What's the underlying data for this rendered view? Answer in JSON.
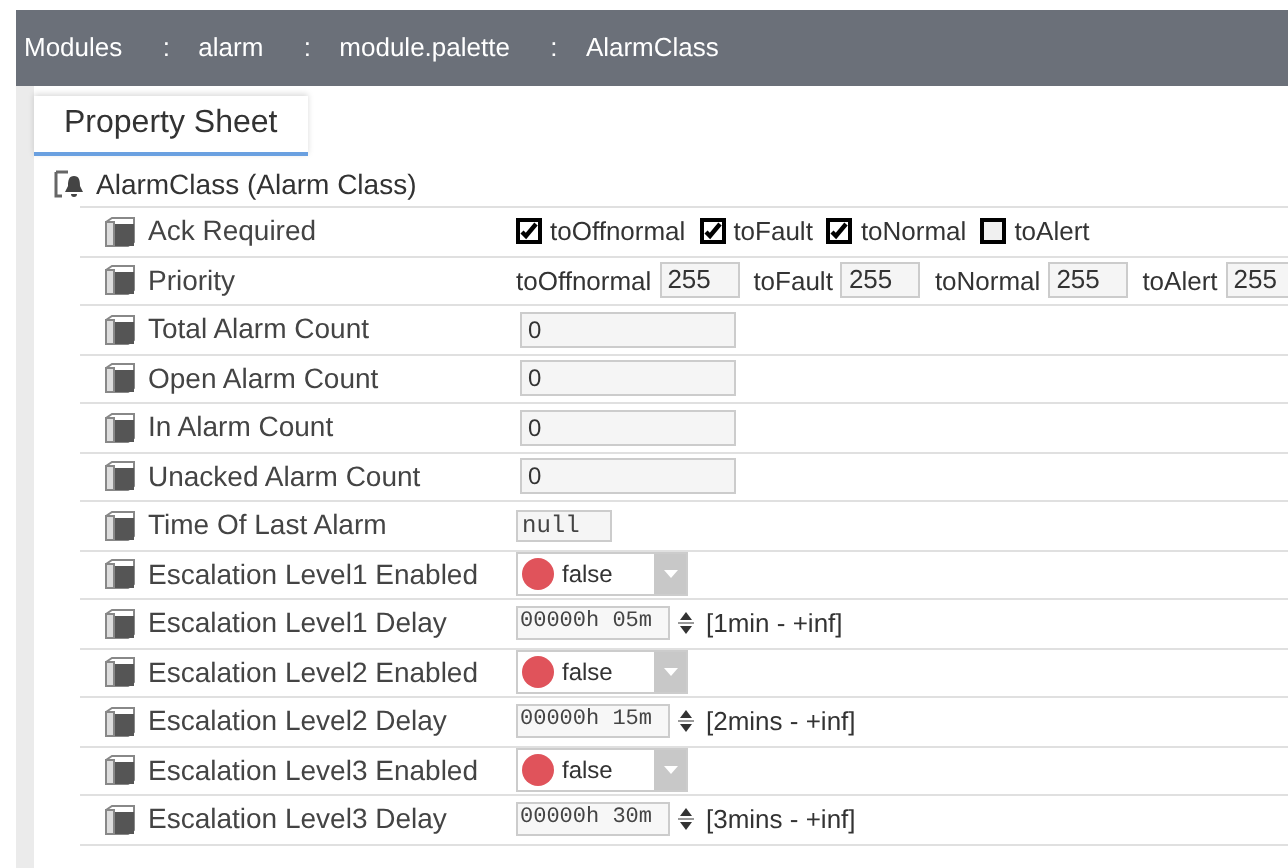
{
  "breadcrumb": [
    {
      "label": "Modules"
    },
    {
      "separator": ":",
      "label": "alarm"
    },
    {
      "separator": ":",
      "label": "module.palette"
    },
    {
      "separator": ":",
      "label": "AlarmClass"
    }
  ],
  "tabs": [
    {
      "label": "Property Sheet",
      "selected": true
    }
  ],
  "root": {
    "label": "AlarmClass  (Alarm Class)"
  },
  "properties": [
    {
      "label": "Ack Required",
      "kind": "checks",
      "checks": [
        {
          "label": "toOffnormal",
          "checked": true
        },
        {
          "label": "toFault",
          "checked": true
        },
        {
          "label": "toNormal",
          "checked": true
        },
        {
          "label": "toAlert",
          "checked": false
        }
      ]
    },
    {
      "label": "Priority",
      "kind": "priority",
      "fields": [
        {
          "label": "toOffnormal",
          "value": "255"
        },
        {
          "label": "toFault",
          "value": "255"
        },
        {
          "label": "toNormal",
          "value": "255"
        },
        {
          "label": "toAlert",
          "value": "255"
        }
      ]
    },
    {
      "label": "Total Alarm Count",
      "kind": "text",
      "value": "0"
    },
    {
      "label": "Open Alarm Count",
      "kind": "text",
      "value": "0"
    },
    {
      "label": "In Alarm Count",
      "kind": "text",
      "value": "0"
    },
    {
      "label": "Unacked Alarm Count",
      "kind": "text",
      "value": "0"
    },
    {
      "label": "Time Of Last Alarm",
      "kind": "readonly",
      "value": "null"
    },
    {
      "label": "Escalation Level1 Enabled",
      "kind": "enum",
      "value": "false",
      "color": "#e0535b"
    },
    {
      "label": "Escalation Level1 Delay",
      "kind": "reltime",
      "value": "00000h 05m",
      "range": "[1min - +inf]"
    },
    {
      "label": "Escalation Level2 Enabled",
      "kind": "enum",
      "value": "false",
      "color": "#e0535b"
    },
    {
      "label": "Escalation Level2 Delay",
      "kind": "reltime",
      "value": "00000h 15m",
      "range": "[2mins - +inf]"
    },
    {
      "label": "Escalation Level3 Enabled",
      "kind": "enum",
      "value": "false",
      "color": "#e0535b"
    },
    {
      "label": "Escalation Level3 Delay",
      "kind": "reltime",
      "value": "00000h 30m",
      "range": "[3mins - +inf]"
    }
  ]
}
